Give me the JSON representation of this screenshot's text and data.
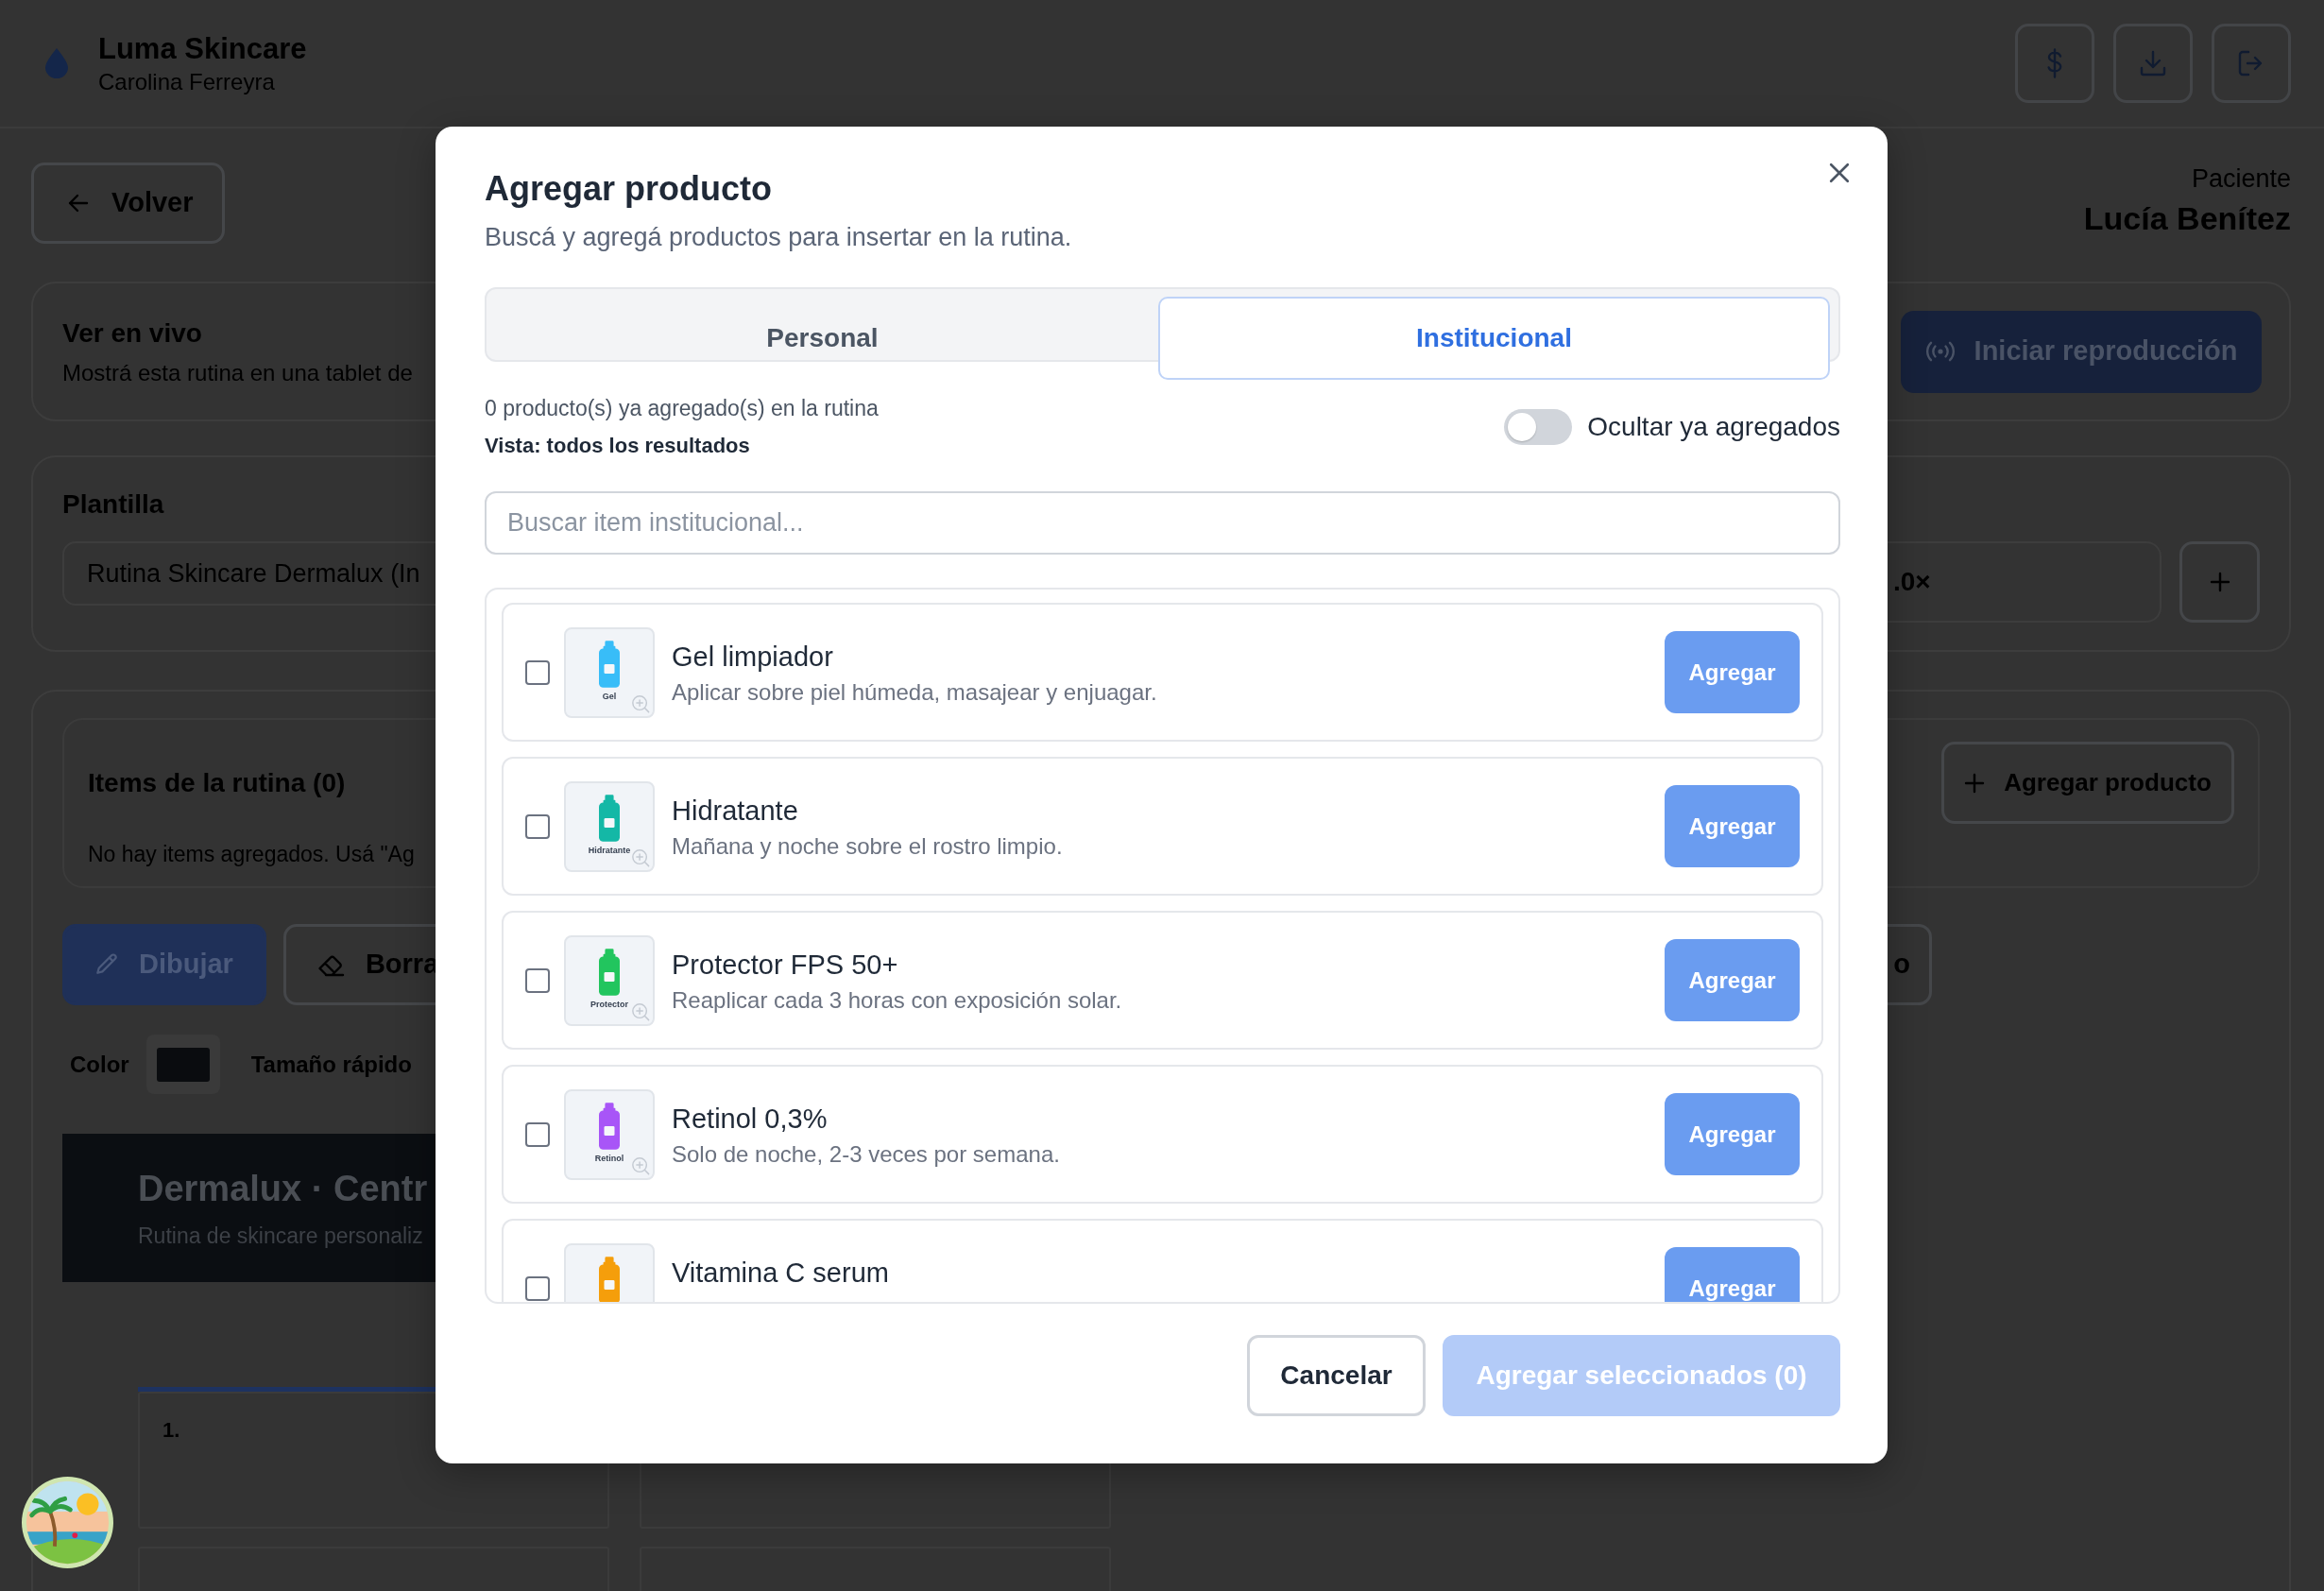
{
  "app": {
    "brand": "Luma Skincare",
    "user": "Carolina Ferreyra"
  },
  "page": {
    "back_button": "Volver",
    "patient_label": "Paciente",
    "patient_name": "Lucía Benítez",
    "live": {
      "title": "Ver en vivo",
      "description": "Mostrá esta rutina en una tablet de",
      "button": "Iniciar reproducción"
    },
    "template": {
      "title": "Plantilla",
      "value": "Rutina Skincare Dermalux (In",
      "scale": ".0×"
    },
    "items": {
      "title": "Items de la rutina (0)",
      "empty_text": "No hay items agregados. Usá \"Ag",
      "button": "Agregar producto"
    },
    "tools": [
      {
        "label": "Dibujar",
        "selected": true
      },
      {
        "label": "Borra",
        "selected": false
      }
    ],
    "tool_right": "o",
    "color_label": "Color",
    "size_label": "Tamaño rápido",
    "banner": {
      "title": "Dermalux · Centr",
      "subtitle": "Rutina de skincare personaliz"
    },
    "steps": [
      {
        "number": "1."
      }
    ]
  },
  "modal": {
    "title": "Agregar producto",
    "subtitle": "Buscá y agregá productos para insertar en la rutina.",
    "tabs": [
      {
        "label": "Personal",
        "selected": false
      },
      {
        "label": "Institucional",
        "selected": true
      }
    ],
    "count_text": "0 producto(s) ya agregado(s) en la rutina",
    "view_text": "Vista: todos los resultados",
    "hide_toggle": {
      "label": "Ocultar ya agregados",
      "on": false
    },
    "search": {
      "placeholder": "Buscar item institucional..."
    },
    "products": [
      {
        "name": "Gel limpiador",
        "description": "Aplicar sobre piel húmeda, masajear y enjuagar.",
        "thumb_label": "Gel",
        "color": "#38bdf8",
        "checked": false,
        "button": "Agregar"
      },
      {
        "name": "Hidratante",
        "description": "Mañana y noche sobre el rostro limpio.",
        "thumb_label": "Hidratante",
        "color": "#14b8a6",
        "checked": false,
        "button": "Agregar"
      },
      {
        "name": "Protector FPS 50+",
        "description": "Reaplicar cada 3 horas con exposición solar.",
        "thumb_label": "Protector",
        "color": "#22c55e",
        "checked": false,
        "button": "Agregar"
      },
      {
        "name": "Retinol 0,3%",
        "description": "Solo de noche, 2-3 veces por semana.",
        "thumb_label": "Retinol",
        "color": "#a855f7",
        "checked": false,
        "button": "Agregar"
      },
      {
        "name": "Vitamina C serum",
        "color": "#f59e0b",
        "checked": false,
        "button": "Agregar"
      }
    ],
    "cancel": "Cancelar",
    "submit": {
      "label": "Agregar seleccionados (0)",
      "disabled": true
    }
  }
}
